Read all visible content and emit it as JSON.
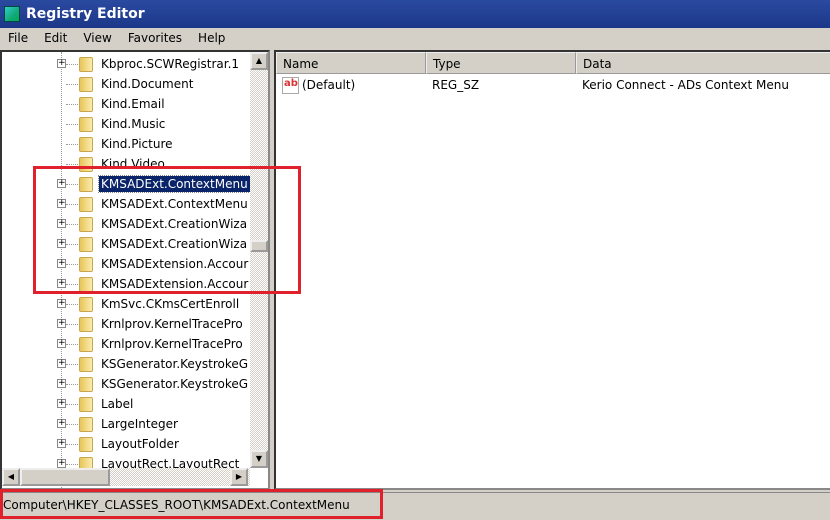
{
  "window": {
    "title": "Registry Editor",
    "icon": "registry-editor-icon"
  },
  "menu": [
    "File",
    "Edit",
    "View",
    "Favorites",
    "Help"
  ],
  "tree": {
    "items": [
      {
        "label": "Kbproc.SCWRegistrar.1",
        "expandable": true
      },
      {
        "label": "Kind.Document",
        "expandable": false
      },
      {
        "label": "Kind.Email",
        "expandable": false
      },
      {
        "label": "Kind.Music",
        "expandable": false
      },
      {
        "label": "Kind.Picture",
        "expandable": false
      },
      {
        "label": "Kind.Video",
        "expandable": false
      },
      {
        "label": "KMSADExt.ContextMenu",
        "expandable": true,
        "selected": true
      },
      {
        "label": "KMSADExt.ContextMenu",
        "expandable": true
      },
      {
        "label": "KMSADExt.CreationWiza",
        "expandable": true
      },
      {
        "label": "KMSADExt.CreationWiza",
        "expandable": true
      },
      {
        "label": "KMSADExtension.Accour",
        "expandable": true
      },
      {
        "label": "KMSADExtension.Accour",
        "expandable": true
      },
      {
        "label": "KmSvc.CKmsCertEnroll",
        "expandable": true
      },
      {
        "label": "Krnlprov.KernelTracePro",
        "expandable": true
      },
      {
        "label": "Krnlprov.KernelTracePro",
        "expandable": true
      },
      {
        "label": "KSGenerator.KeystrokeG",
        "expandable": true
      },
      {
        "label": "KSGenerator.KeystrokeG",
        "expandable": true
      },
      {
        "label": "Label",
        "expandable": true
      },
      {
        "label": "LargeInteger",
        "expandable": true
      },
      {
        "label": "LayoutFolder",
        "expandable": true
      },
      {
        "label": "LayoutRect.LayoutRect",
        "expandable": true
      }
    ]
  },
  "values": {
    "columns": [
      "Name",
      "Type",
      "Data"
    ],
    "rows": [
      {
        "name": "(Default)",
        "type": "REG_SZ",
        "data": "Kerio Connect - ADs Context Menu",
        "icon": "string-value-icon"
      }
    ]
  },
  "status": "Computer\\HKEY_CLASSES_ROOT\\KMSADExt.ContextMenu",
  "highlight_color": "#e0202a"
}
